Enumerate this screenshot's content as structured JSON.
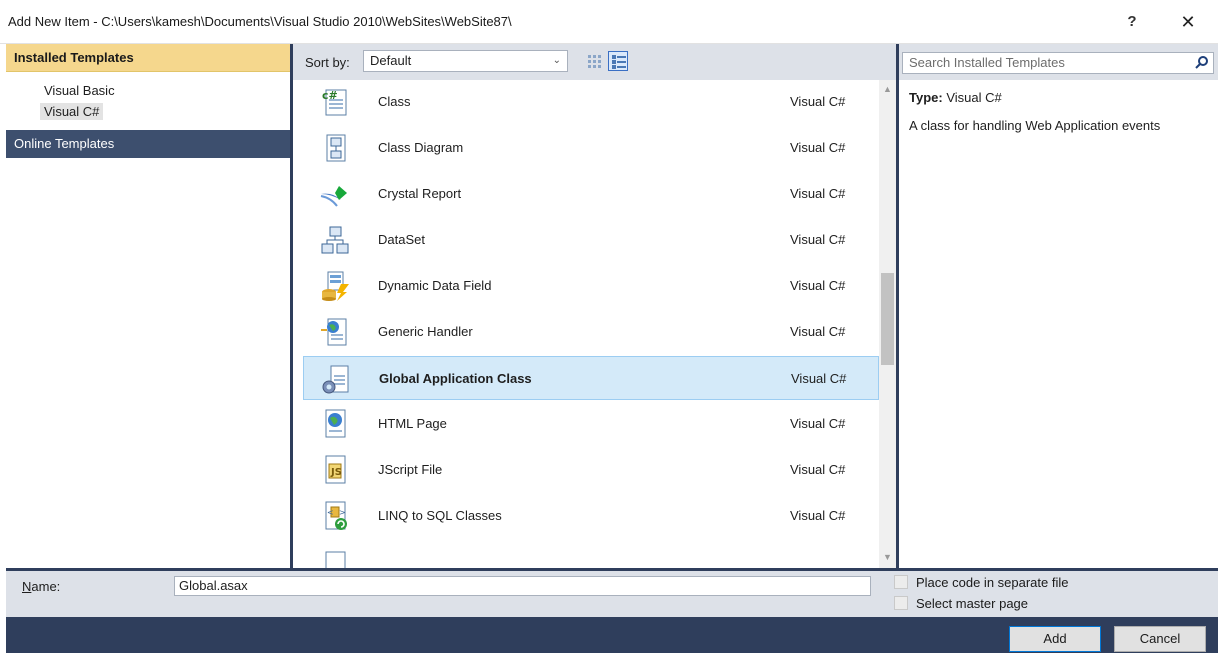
{
  "window": {
    "title": "Add New Item - C:\\Users\\kamesh\\Documents\\Visual Studio 2010\\WebSites\\WebSite87\\",
    "help_label": "?",
    "close_label": "✕"
  },
  "left_pane": {
    "header": "Installed Templates",
    "tree": [
      {
        "label": "Visual Basic",
        "selected": false
      },
      {
        "label": "Visual C#",
        "selected": true
      }
    ],
    "online": "Online Templates"
  },
  "toolbar": {
    "sort_label": "Sort by:",
    "sort_value": "Default"
  },
  "templates": [
    {
      "name": "Class",
      "lang": "Visual C#",
      "icon": "class-icon",
      "selected": false
    },
    {
      "name": "Class Diagram",
      "lang": "Visual C#",
      "icon": "class-diagram-icon",
      "selected": false
    },
    {
      "name": "Crystal Report",
      "lang": "Visual C#",
      "icon": "crystal-report-icon",
      "selected": false
    },
    {
      "name": "DataSet",
      "lang": "Visual C#",
      "icon": "dataset-icon",
      "selected": false
    },
    {
      "name": "Dynamic Data Field",
      "lang": "Visual C#",
      "icon": "dynamic-data-field-icon",
      "selected": false
    },
    {
      "name": "Generic Handler",
      "lang": "Visual C#",
      "icon": "generic-handler-icon",
      "selected": false
    },
    {
      "name": "Global Application Class",
      "lang": "Visual C#",
      "icon": "global-application-class-icon",
      "selected": true
    },
    {
      "name": "HTML Page",
      "lang": "Visual C#",
      "icon": "html-page-icon",
      "selected": false
    },
    {
      "name": "JScript File",
      "lang": "Visual C#",
      "icon": "jscript-file-icon",
      "selected": false
    },
    {
      "name": "LINQ to SQL Classes",
      "lang": "Visual C#",
      "icon": "linq-to-sql-icon",
      "selected": false
    }
  ],
  "right_pane": {
    "search_placeholder": "Search Installed Templates",
    "type_label": "Type:",
    "type_value": "Visual C#",
    "description": "A class for handling Web Application events"
  },
  "bottom": {
    "name_label": "Name:",
    "name_value": "Global.asax",
    "place_code_label": "Place code in separate file",
    "select_master_label": "Select master page",
    "add_label": "Add",
    "cancel_label": "Cancel"
  },
  "colors": {
    "frame": "#2f3e5c",
    "header_gold": "#f5d78d",
    "selection": "#d4eaf9",
    "toolbar": "#dde1e8"
  }
}
